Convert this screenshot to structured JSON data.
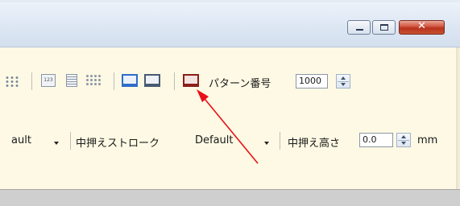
{
  "window": {
    "close_glyph": "✕"
  },
  "toolbar1": {
    "icons": [
      "grid-dots-icon",
      "counter-123-icon",
      "list-icon",
      "scatter-icon",
      "sewing-machine-blue-icon",
      "sewing-machine-gray-icon",
      "sewing-machine-red-icon"
    ],
    "counter_icon_text": "123",
    "pattern_label": "パターン番号",
    "pattern_value": "1000"
  },
  "toolbar2": {
    "dropdown1_value": "ault",
    "stroke_label": "中押えストローク",
    "stroke_value": "Default",
    "height_label": "中押え高さ",
    "height_value": "0.0",
    "height_unit": "mm"
  },
  "colors": {
    "panel": "#fdf9e4",
    "annotation_arrow": "#e8101a"
  }
}
